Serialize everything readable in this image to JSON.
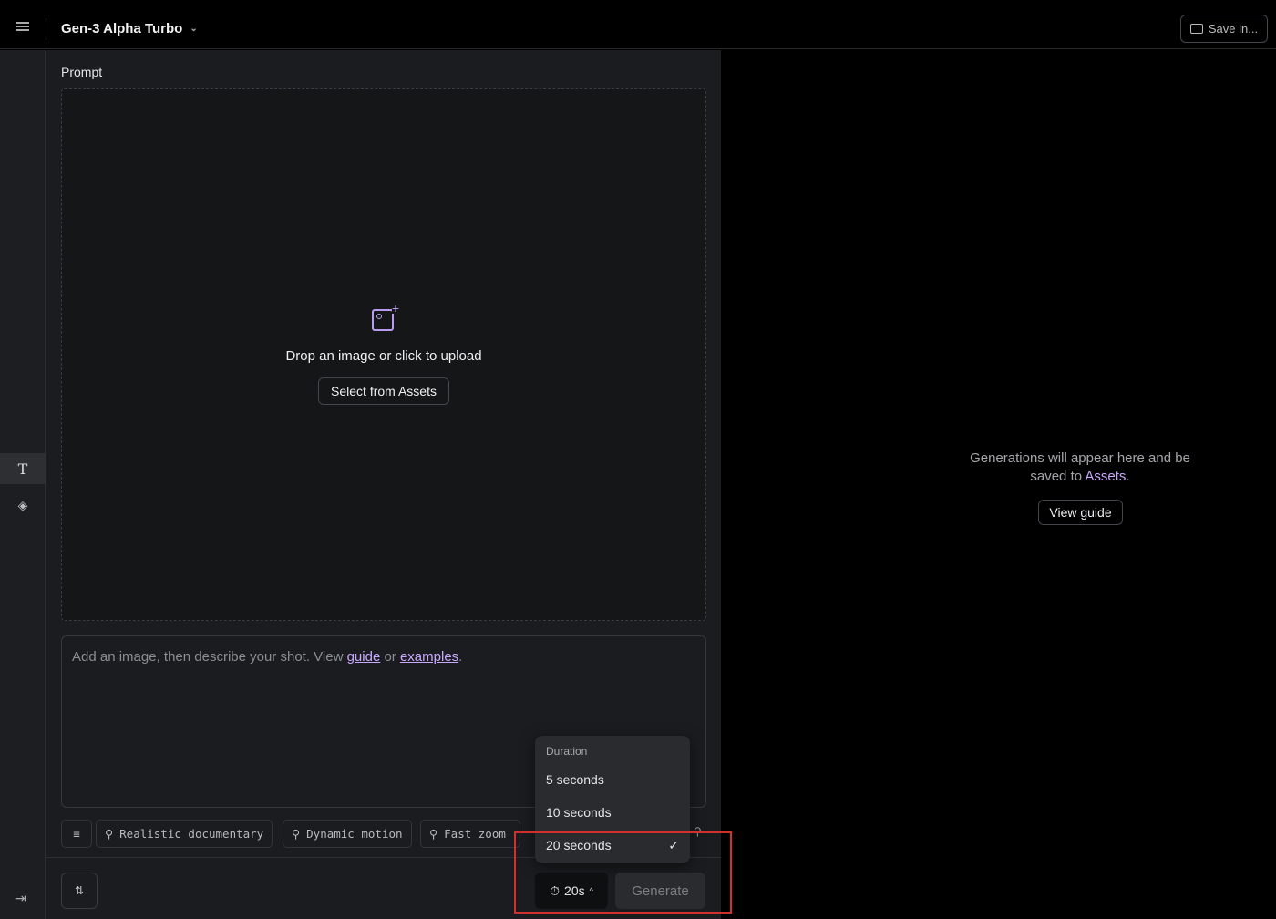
{
  "header": {
    "model": "Gen-3 Alpha Turbo",
    "save_label": "Save in..."
  },
  "prompt": {
    "label": "Prompt",
    "upload_text": "Drop an image or click to upload",
    "select_assets": "Select from Assets",
    "placeholder_prefix": "Add an image, then describe your shot. View ",
    "guide": "guide",
    "or": " or ",
    "examples": "examples",
    "period": "."
  },
  "chips": [
    "Realistic documentary",
    "Dynamic motion",
    "Fast zoom"
  ],
  "duration_menu": {
    "title": "Duration",
    "options": [
      "5 seconds",
      "10 seconds",
      "20 seconds"
    ],
    "selected": "20 seconds"
  },
  "footer": {
    "duration_value": "20s",
    "generate": "Generate"
  },
  "output": {
    "message_line1": "Generations will appear here and be",
    "message_line2_prefix": "saved to ",
    "assets_link": "Assets",
    "message_period": ".",
    "view_guide": "View guide"
  },
  "colors": {
    "accent": "#c9a8ff",
    "highlight_box": "#d0312d"
  }
}
